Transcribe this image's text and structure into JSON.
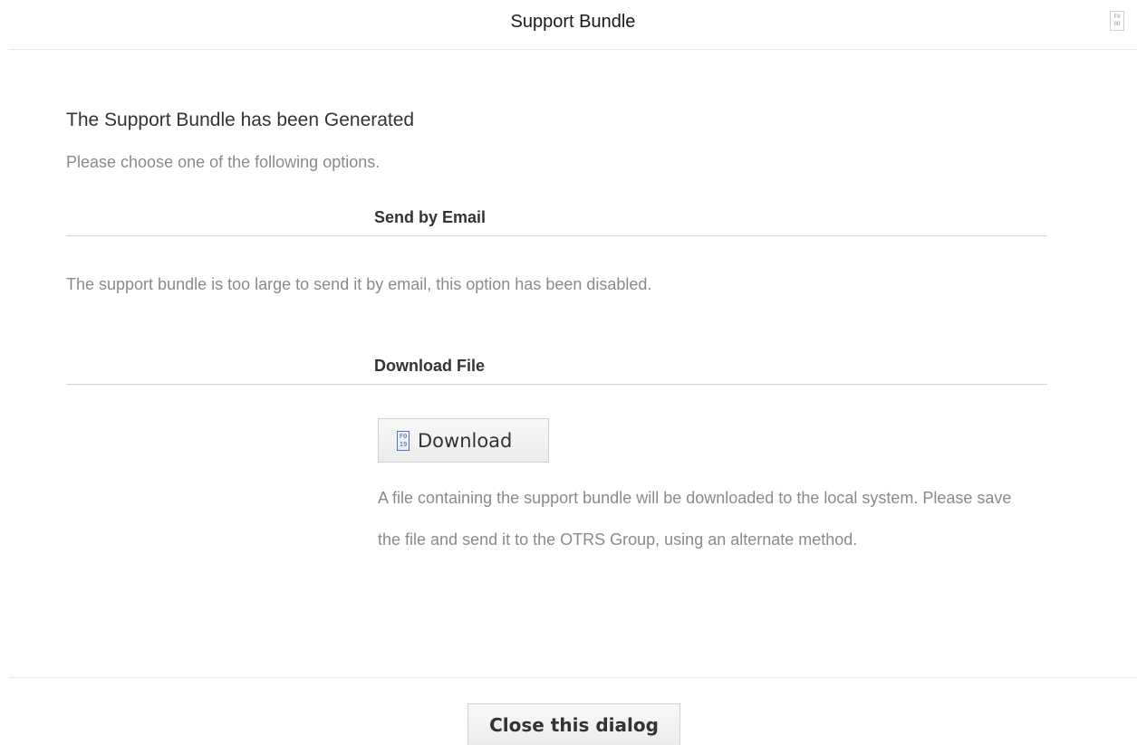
{
  "dialog": {
    "title": "Support Bundle",
    "close_icon": "close-icon"
  },
  "main": {
    "heading": "The Support Bundle has been Generated",
    "subheading": "Please choose one of the following options.",
    "email_section": {
      "title": "Send by Email",
      "note": "The support bundle is too large to send it by email, this option has been disabled."
    },
    "download_section": {
      "title": "Download File",
      "button_label": "Download",
      "button_icon": "download-icon",
      "description": "A file containing the support bundle will be downloaded to the local system. Please save the file and send it to the OTRS Group, using an alternate method."
    }
  },
  "footer": {
    "close_button_label": "Close this dialog"
  }
}
